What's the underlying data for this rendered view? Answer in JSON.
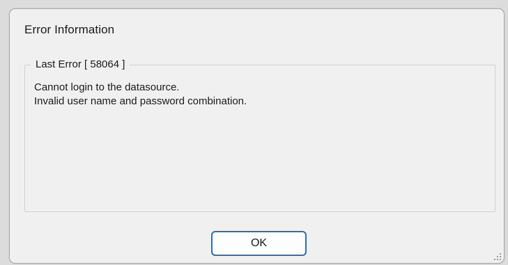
{
  "dialog": {
    "title": "Error Information",
    "group": {
      "legend": "Last Error [ 58064 ]",
      "message_lines": [
        "Cannot login to the datasource.",
        "Invalid user name and password combination."
      ]
    },
    "ok_label": "OK"
  },
  "icons": {
    "resize_grip": "resize-grip-icon"
  },
  "colors": {
    "dialog_background": "#f0f0f0",
    "button_border_accent": "#2c6fb3"
  }
}
